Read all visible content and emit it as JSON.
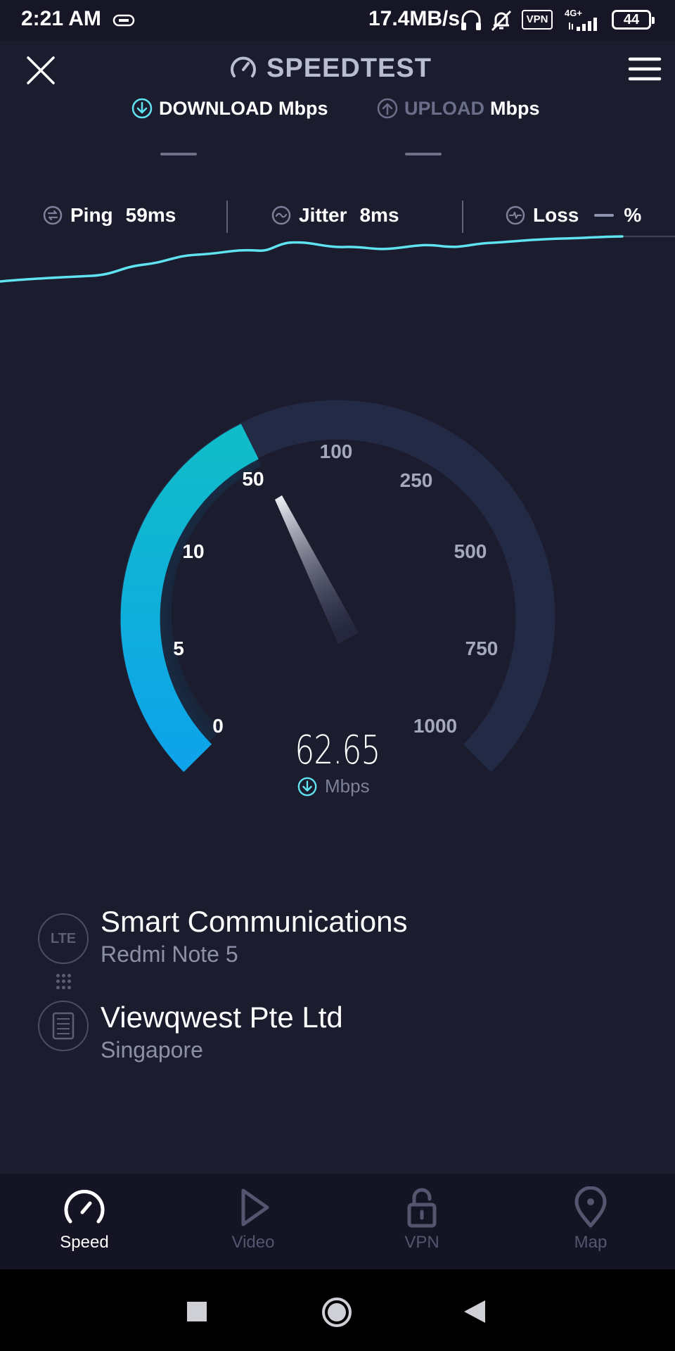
{
  "status_bar": {
    "time": "2:21 AM",
    "net_speed": "17.4MB/s",
    "vpn_badge": "VPN",
    "network_type": "4G+",
    "battery": "44"
  },
  "header": {
    "title": "SPEEDTEST",
    "tabs": [
      {
        "label": "DOWNLOAD",
        "unit": "Mbps",
        "value": "—",
        "active": true
      },
      {
        "label": "UPLOAD",
        "unit": "Mbps",
        "value": "—",
        "active": false
      }
    ]
  },
  "metrics": [
    {
      "label": "Ping",
      "value": "59ms"
    },
    {
      "label": "Jitter",
      "value": "8ms"
    },
    {
      "label": "Loss",
      "value": "%"
    }
  ],
  "gauge": {
    "scale_labels": [
      "0",
      "5",
      "10",
      "50",
      "100",
      "250",
      "500",
      "750",
      "1000"
    ],
    "reading": "62.65",
    "reading_unit": "Mbps",
    "active_color": "#12b8d6",
    "track_color": "#232a45"
  },
  "connection": {
    "provider": {
      "badge": "LTE",
      "name": "Smart Communications",
      "device": "Redmi Note 5"
    },
    "server": {
      "name": "Viewqwest Pte Ltd",
      "location": "Singapore"
    }
  },
  "bottom_nav": [
    {
      "label": "Speed",
      "icon": "speedometer-icon",
      "active": true
    },
    {
      "label": "Video",
      "icon": "play-icon",
      "active": false
    },
    {
      "label": "VPN",
      "icon": "unlock-icon",
      "active": false
    },
    {
      "label": "Map",
      "icon": "map-pin-icon",
      "active": false
    }
  ],
  "system_nav": {
    "icons": [
      "square-recents-icon",
      "circle-home-icon",
      "triangle-back-icon"
    ]
  },
  "colors": {
    "background": "#1b1c2e",
    "accent": "#5fe3f0",
    "gauge_blue": "#0ea5e9"
  }
}
